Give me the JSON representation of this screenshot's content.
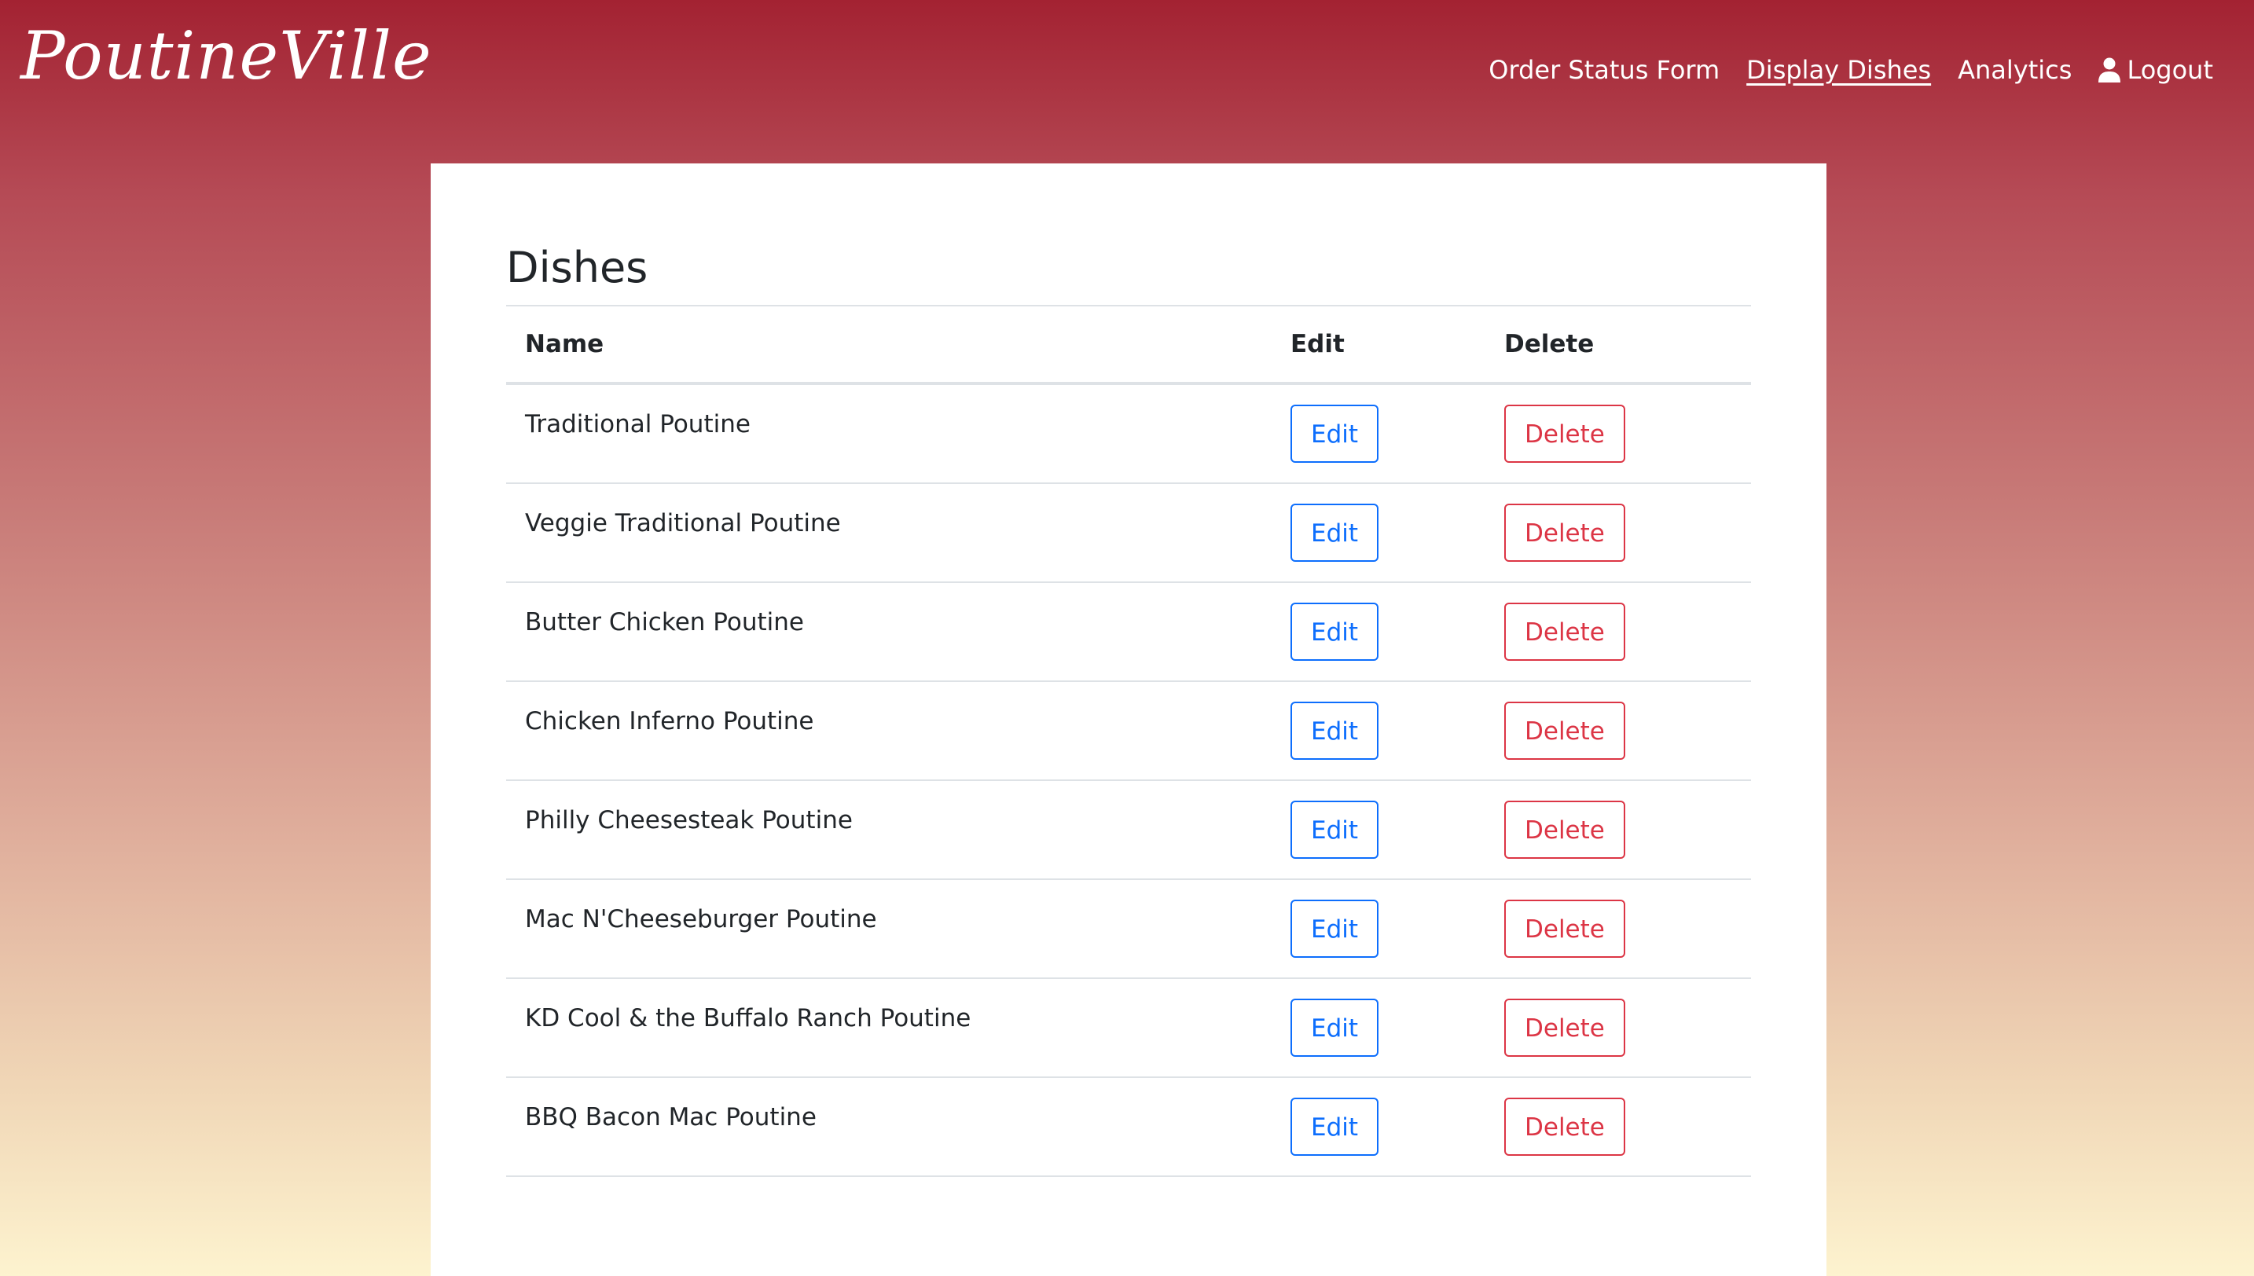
{
  "brand": {
    "logo_text": "PoutineVille"
  },
  "nav": {
    "items": [
      {
        "label": "Order Status Form"
      },
      {
        "label": "Display Dishes",
        "active": true
      },
      {
        "label": "Analytics"
      }
    ],
    "logout_label": "Logout",
    "logout_icon": "user-icon"
  },
  "main": {
    "title": "Dishes",
    "columns": {
      "name": "Name",
      "edit": "Edit",
      "delete": "Delete"
    },
    "edit_label": "Edit",
    "delete_label": "Delete",
    "dishes": [
      "Traditional Poutine",
      "Veggie Traditional Poutine",
      "Butter Chicken Poutine",
      "Chicken Inferno Poutine",
      "Philly Cheesesteak Poutine",
      "Mac N'Cheeseburger Poutine",
      "KD Cool & the Buffalo Ranch Poutine",
      "BBQ Bacon Mac Poutine"
    ]
  },
  "colors": {
    "header_red": "#a32232",
    "edit_blue": "#0d6efd",
    "delete_red": "#dc3545"
  }
}
